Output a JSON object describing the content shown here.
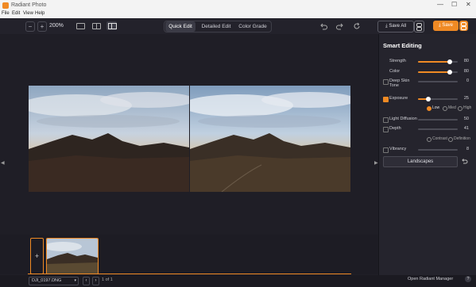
{
  "window": {
    "title": "Radiant Photo",
    "controls": [
      "—",
      "☐",
      "✕"
    ]
  },
  "menu": [
    "File",
    "Edit",
    "View",
    "Help"
  ],
  "toolbar": {
    "zoom_out": "−",
    "zoom_in": "+",
    "zoom": "200%",
    "tabs": [
      "Quick Edit",
      "Detailed Edit",
      "Color Grade"
    ],
    "active_tab": "Quick Edit",
    "save_all": "Save All",
    "save": "Save"
  },
  "panel": {
    "title": "Smart Editing",
    "sliders": [
      {
        "label": "Strength",
        "value": "80",
        "checkable": false,
        "checked": false,
        "fraction": 0.8
      },
      {
        "label": "Color",
        "value": "80",
        "checkable": false,
        "checked": false,
        "fraction": 0.8
      },
      {
        "label": "Deep Skin Tone",
        "value": "0",
        "checkable": true,
        "checked": false,
        "fraction": 0
      },
      {
        "label": "Exposure",
        "value": "25",
        "checkable": true,
        "checked": true,
        "fraction": 0.25
      },
      {
        "label": "Light Diffusion",
        "value": "50",
        "checkable": true,
        "checked": false,
        "fraction": 0.5
      },
      {
        "label": "Depth",
        "value": "41",
        "checkable": true,
        "checked": false,
        "fraction": 0.41
      },
      {
        "label": "Vibrancy",
        "value": "8",
        "checkable": true,
        "checked": false,
        "fraction": 0.08
      }
    ],
    "exposure_modes": [
      "Low",
      "Med",
      "High"
    ],
    "exposure_mode_selected": "Low",
    "depth_modes": [
      "Contrast",
      "Definition"
    ],
    "preset": "Landscapes"
  },
  "filmstrip": {
    "add": "+",
    "filename": "DJI_0197.DNG",
    "page": "1 of 1"
  },
  "footer": {
    "open_manager": "Open Radiant Manager",
    "help": "?"
  },
  "colors": {
    "accent": "#f08a24",
    "background": "#1f1e26",
    "panel": "#25242d"
  }
}
